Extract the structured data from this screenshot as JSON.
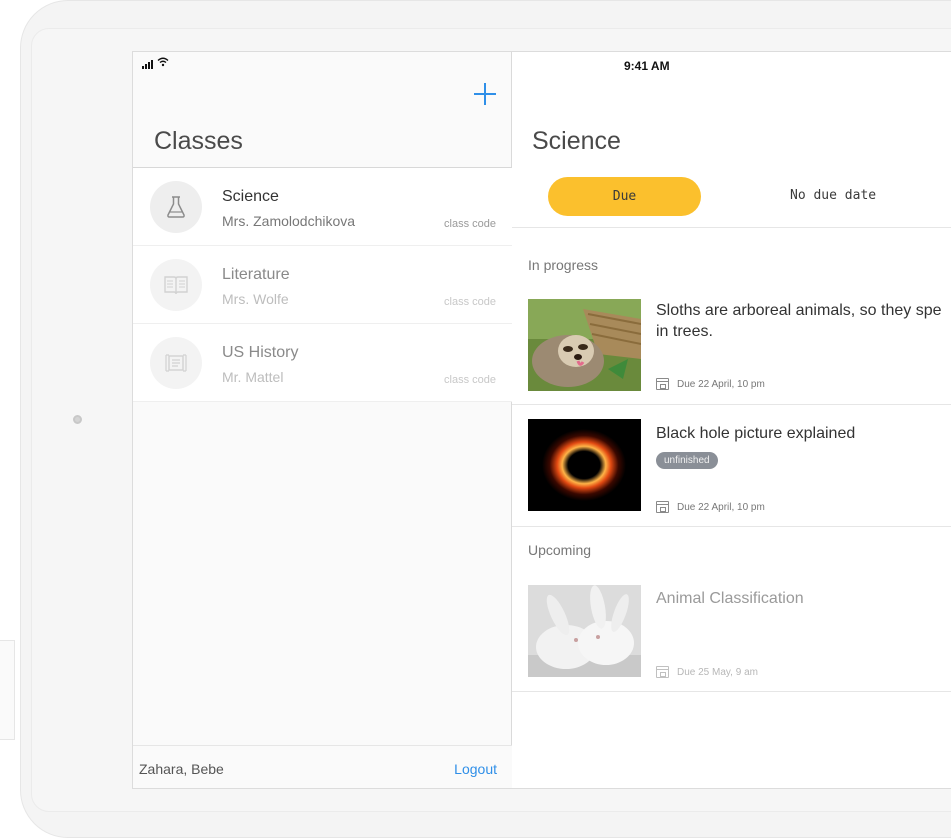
{
  "status_bar": {
    "time": "9:41 AM",
    "wifi_icon": "wifi-icon",
    "signal_icon": "signal-icon"
  },
  "left_panel": {
    "title": "Classes",
    "add_icon": "plus-icon",
    "classes": [
      {
        "name": "Science",
        "teacher": "Mrs. Zamolodchikova",
        "code_label": "class code",
        "icon": "flask-icon"
      },
      {
        "name": "Literature",
        "teacher": "Mrs. Wolfe",
        "code_label": "class code",
        "icon": "book-icon"
      },
      {
        "name": "US History",
        "teacher": "Mr. Mattel",
        "code_label": "class code",
        "icon": "scroll-icon"
      }
    ],
    "footer": {
      "user": "Zahara, Bebe",
      "logout_label": "Logout"
    }
  },
  "right_panel": {
    "title": "Science",
    "tabs": [
      {
        "label": "Due",
        "selected": true
      },
      {
        "label": "No due date",
        "selected": false
      }
    ],
    "sections": [
      {
        "label": "In progress",
        "items": [
          {
            "title": "Sloths are arboreal animals, so they spe",
            "title_line2": "in trees.",
            "due": "Due 22 April, 10 pm",
            "thumb": "sloth-photo"
          },
          {
            "title": "Black hole picture explained",
            "badge": "unfinished",
            "due": "Due 22 April, 10 pm",
            "thumb": "black-hole-photo"
          }
        ]
      },
      {
        "label": "Upcoming",
        "items": [
          {
            "title": "Animal Classification",
            "due": "Due 25 May, 9 am",
            "thumb": "rabbits-photo"
          }
        ]
      }
    ]
  },
  "colors": {
    "accent": "#2f8fe8",
    "tab_selected": "#fbc02d",
    "badge": "#8a8f97"
  }
}
